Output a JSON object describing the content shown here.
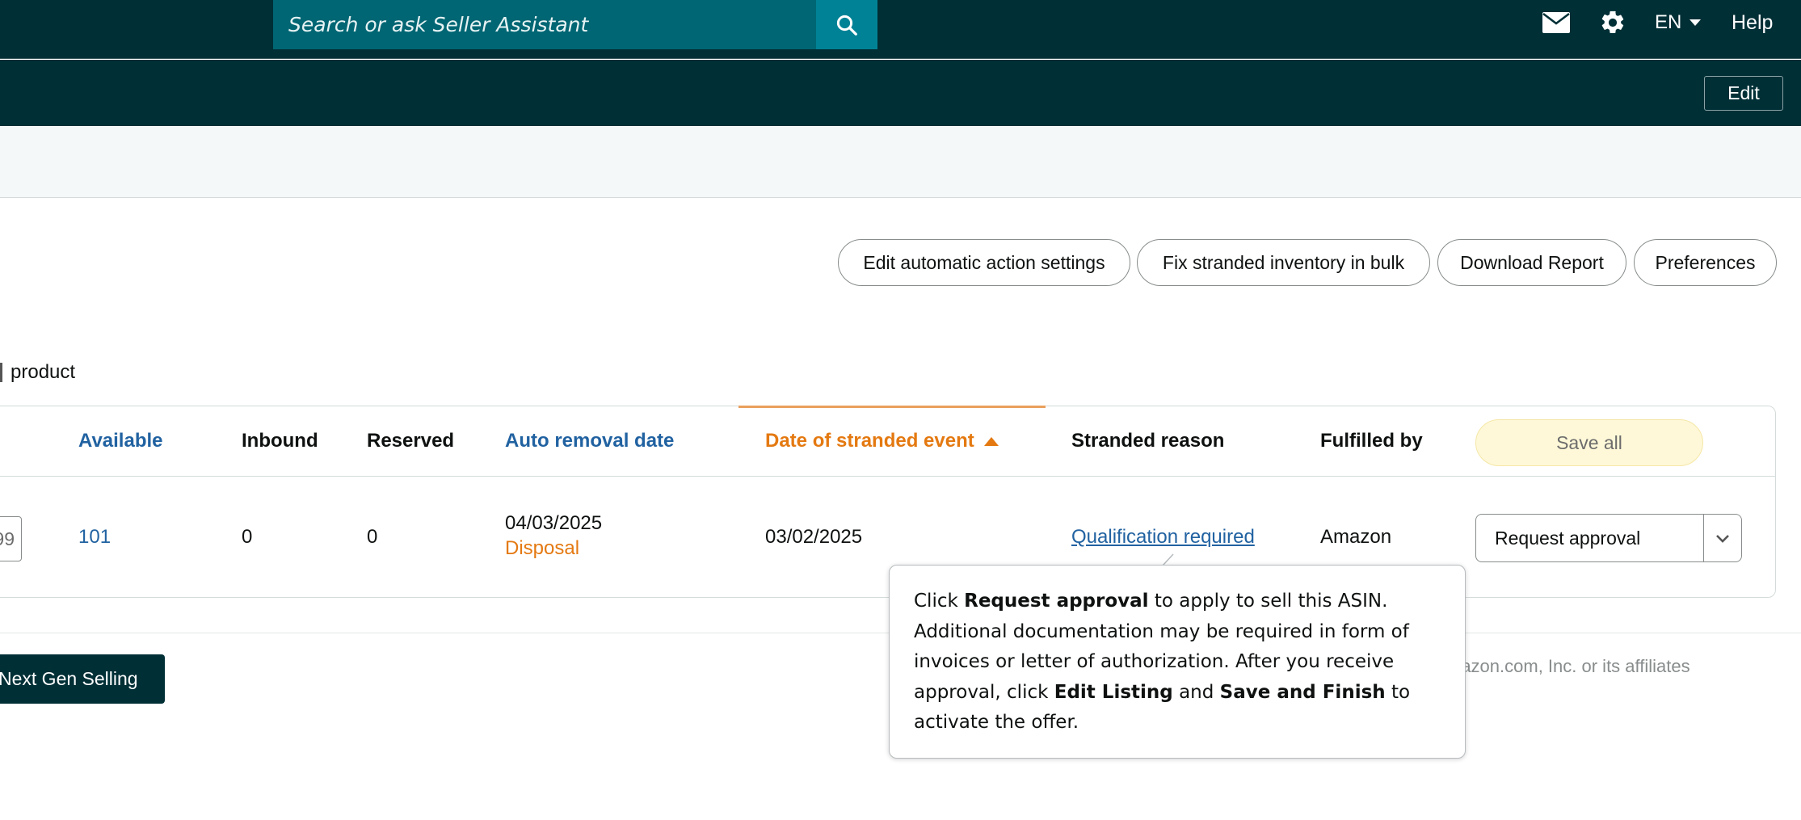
{
  "topbar": {
    "search_placeholder": "Search or ask Seller Assistant",
    "search_icon": "search-icon",
    "mail_icon": "mail-icon",
    "settings_icon": "gear-icon",
    "language": "EN",
    "help": "Help"
  },
  "subbar": {
    "edit_label": "Edit"
  },
  "actions": [
    "Edit automatic action settings",
    "Fix stranded inventory in bulk",
    "Download Report",
    "Preferences"
  ],
  "product_count_label": "product",
  "table": {
    "headers": {
      "available": "Available",
      "inbound": "Inbound",
      "reserved": "Reserved",
      "auto_removal_date": "Auto removal date",
      "date_of_stranded_event": "Date of stranded event",
      "stranded_reason": "Stranded reason",
      "fulfilled_by": "Fulfilled by"
    },
    "sort_direction": "ascending",
    "save_all": "Save all",
    "row": {
      "price_partial": "99",
      "available": "101",
      "inbound": "0",
      "reserved": "0",
      "auto_removal_date": "04/03/2025",
      "auto_removal_action": "Disposal",
      "stranded_date": "03/02/2025",
      "stranded_reason": "Qualification required",
      "fulfilled_by": "Amazon",
      "action": "Request approval"
    }
  },
  "footer": {
    "next_gen_button": "Next Gen Selling",
    "copyright": "mazon.com, Inc. or its affiliates"
  },
  "tooltip": {
    "t1": "Click ",
    "b1": "Request approval",
    "t2": " to apply to sell this ASIN. Additional documentation may be required in form of invoices or letter of authorization. After you receive approval, click ",
    "b2": "Edit Listing",
    "t3": " and ",
    "b3": "Save and Finish",
    "t4": " to activate the offer."
  },
  "colors": {
    "nav_bg": "#002f36",
    "search_bg": "#006673",
    "search_button": "#008296",
    "link": "#2162a1",
    "sorted": "#e47911",
    "save_all_bg": "#fef8d8"
  }
}
